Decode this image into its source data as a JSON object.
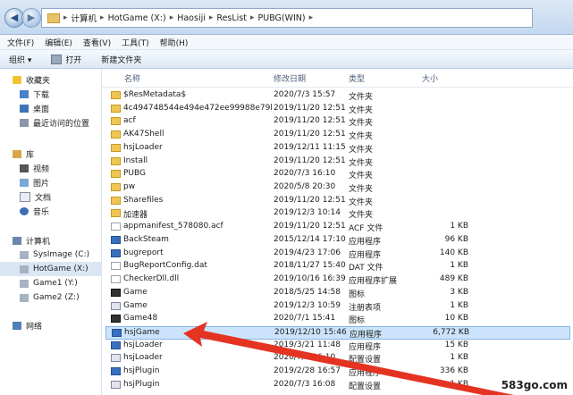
{
  "address": {
    "crumbs": [
      "计算机",
      "HotGame (X:)",
      "Haosiji",
      "ResList",
      "PUBG(WIN)"
    ]
  },
  "menu": [
    "文件(F)",
    "编辑(E)",
    "查看(V)",
    "工具(T)",
    "帮助(H)"
  ],
  "toolbar": {
    "organize": "组织 ▾",
    "open": "打开",
    "new_folder": "新建文件夹"
  },
  "sidebar": {
    "favorites": "收藏夹",
    "fav_items": [
      "下载",
      "桌面",
      "最近访问的位置"
    ],
    "library": "库",
    "lib_items": [
      "视频",
      "图片",
      "文档",
      "音乐"
    ],
    "computer": "计算机",
    "drives": [
      "SysImage (C:)",
      "HotGame (X:)",
      "Game1 (Y:)",
      "Game2 (Z:)"
    ],
    "network": "网络"
  },
  "columns": {
    "name": "名称",
    "date": "修改日期",
    "type": "类型",
    "size": "大小"
  },
  "files": [
    {
      "name": "$ResMetadata$",
      "date": "2020/7/3 15:57",
      "type": "文件夹",
      "size": "",
      "icon": "folder"
    },
    {
      "name": "4c494748544e494e472ee99988e79bb4",
      "date": "2019/11/20 12:51",
      "type": "文件夹",
      "size": "",
      "icon": "folder"
    },
    {
      "name": "acf",
      "date": "2019/11/20 12:51",
      "type": "文件夹",
      "size": "",
      "icon": "folder"
    },
    {
      "name": "AK47Shell",
      "date": "2019/11/20 12:51",
      "type": "文件夹",
      "size": "",
      "icon": "folder"
    },
    {
      "name": "hsjLoader",
      "date": "2019/12/11 11:15",
      "type": "文件夹",
      "size": "",
      "icon": "folder"
    },
    {
      "name": "Install",
      "date": "2019/11/20 12:51",
      "type": "文件夹",
      "size": "",
      "icon": "folder"
    },
    {
      "name": "PUBG",
      "date": "2020/7/3 16:10",
      "type": "文件夹",
      "size": "",
      "icon": "folder"
    },
    {
      "name": "pw",
      "date": "2020/5/8 20:30",
      "type": "文件夹",
      "size": "",
      "icon": "folder"
    },
    {
      "name": "Sharefiles",
      "date": "2019/11/20 12:51",
      "type": "文件夹",
      "size": "",
      "icon": "folder"
    },
    {
      "name": "加速器",
      "date": "2019/12/3 10:14",
      "type": "文件夹",
      "size": "",
      "icon": "folder"
    },
    {
      "name": "appmanifest_578080.acf",
      "date": "2019/11/20 12:51",
      "type": "ACF 文件",
      "size": "1 KB",
      "icon": "file"
    },
    {
      "name": "BackSteam",
      "date": "2015/12/14 17:10",
      "type": "应用程序",
      "size": "96 KB",
      "icon": "app"
    },
    {
      "name": "bugreport",
      "date": "2019/4/23 17:06",
      "type": "应用程序",
      "size": "140 KB",
      "icon": "app"
    },
    {
      "name": "BugReportConfig.dat",
      "date": "2018/11/27 15:40",
      "type": "DAT 文件",
      "size": "1 KB",
      "icon": "file"
    },
    {
      "name": "CheckerDll.dll",
      "date": "2019/10/16 16:39",
      "type": "应用程序扩展",
      "size": "489 KB",
      "icon": "file"
    },
    {
      "name": "Game",
      "date": "2018/5/25 14:58",
      "type": "图标",
      "size": "3 KB",
      "icon": "ico"
    },
    {
      "name": "Game",
      "date": "2019/12/3 10:59",
      "type": "注册表项",
      "size": "1 KB",
      "icon": "cfg"
    },
    {
      "name": "Game48",
      "date": "2020/7/1 15:41",
      "type": "图标",
      "size": "10 KB",
      "icon": "ico"
    },
    {
      "name": "hsjGame",
      "date": "2019/12/10 15:46",
      "type": "应用程序",
      "size": "6,772 KB",
      "icon": "app"
    },
    {
      "name": "hsjLoader",
      "date": "2019/3/21 11:48",
      "type": "应用程序",
      "size": "15 KB",
      "icon": "app"
    },
    {
      "name": "hsjLoader",
      "date": "2020/7/3 16:10",
      "type": "配置设置",
      "size": "1 KB",
      "icon": "cfg"
    },
    {
      "name": "hsjPlugin",
      "date": "2019/2/28 16:57",
      "type": "应用程序",
      "size": "336 KB",
      "icon": "app"
    },
    {
      "name": "hsjPlugin",
      "date": "2020/7/3 16:08",
      "type": "配置设置",
      "size": "1 KB",
      "icon": "cfg"
    }
  ],
  "selected_file": "hsjGame",
  "watermark": "583go.com",
  "colors": {
    "accent": "#cce4fb",
    "arrow": "#e53322"
  }
}
